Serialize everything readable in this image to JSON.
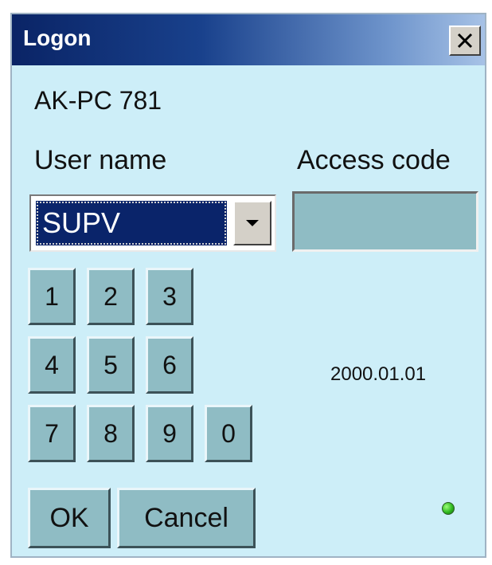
{
  "window": {
    "title": "Logon",
    "close_glyph": "✕",
    "close_icon": "close-icon"
  },
  "device": {
    "name": "AK-PC 781"
  },
  "form": {
    "user_label": "User name",
    "access_label": "Access code",
    "user_value": "SUPV",
    "access_value": ""
  },
  "keypad": {
    "keys": [
      "1",
      "2",
      "3",
      "4",
      "5",
      "6",
      "7",
      "8",
      "9",
      "0"
    ]
  },
  "buttons": {
    "ok": "OK",
    "cancel": "Cancel"
  },
  "status": {
    "date": "2000.01.01",
    "led_color": "#2fb81f",
    "led_icon": "status-led-icon"
  },
  "colors": {
    "window_bg": "#cdeef8",
    "title_bar_start": "#0a2466",
    "button_face": "#8fbcc4",
    "selection_bg": "#0a246a"
  }
}
